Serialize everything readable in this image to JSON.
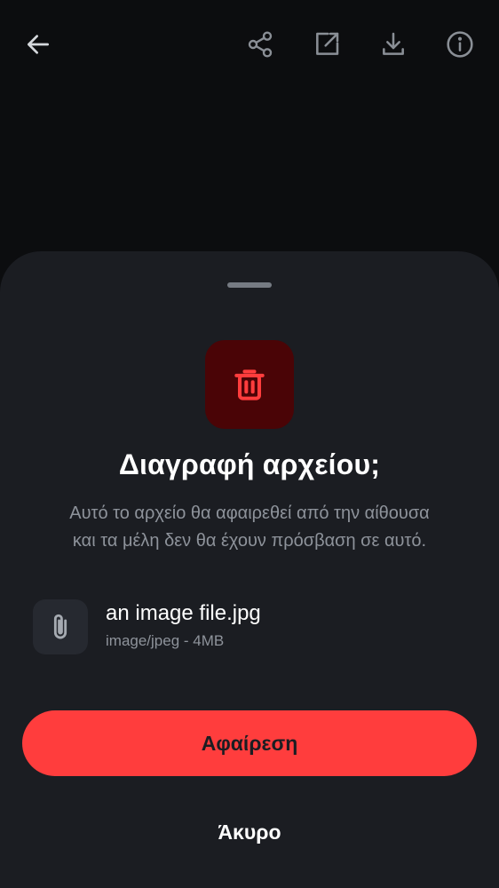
{
  "topbar": {
    "back_icon": "arrow-back-icon",
    "share_icon": "share-icon",
    "open_external_icon": "open-external-icon",
    "download_icon": "download-icon",
    "info_icon": "info-icon"
  },
  "dialog": {
    "icon": "trash-icon",
    "title": "Διαγραφή αρχείου;",
    "description_line1": "Αυτό το αρχείο θα αφαιρεθεί από την αίθουσα",
    "description_line2": "και τα μέλη δεν θα έχουν πρόσβαση σε αυτό.",
    "file": {
      "icon": "paperclip-icon",
      "name": "an image file.jpg",
      "meta": "image/jpeg - 4MB"
    },
    "confirm_label": "Αφαίρεση",
    "cancel_label": "Άκυρο"
  },
  "colors": {
    "background": "#0c0d0f",
    "sheet": "#1b1d22",
    "danger": "#ff3d3d",
    "danger_badge_bg": "#4a0406",
    "icon_gray": "#8a8f96",
    "text_secondary": "#8e939b"
  }
}
